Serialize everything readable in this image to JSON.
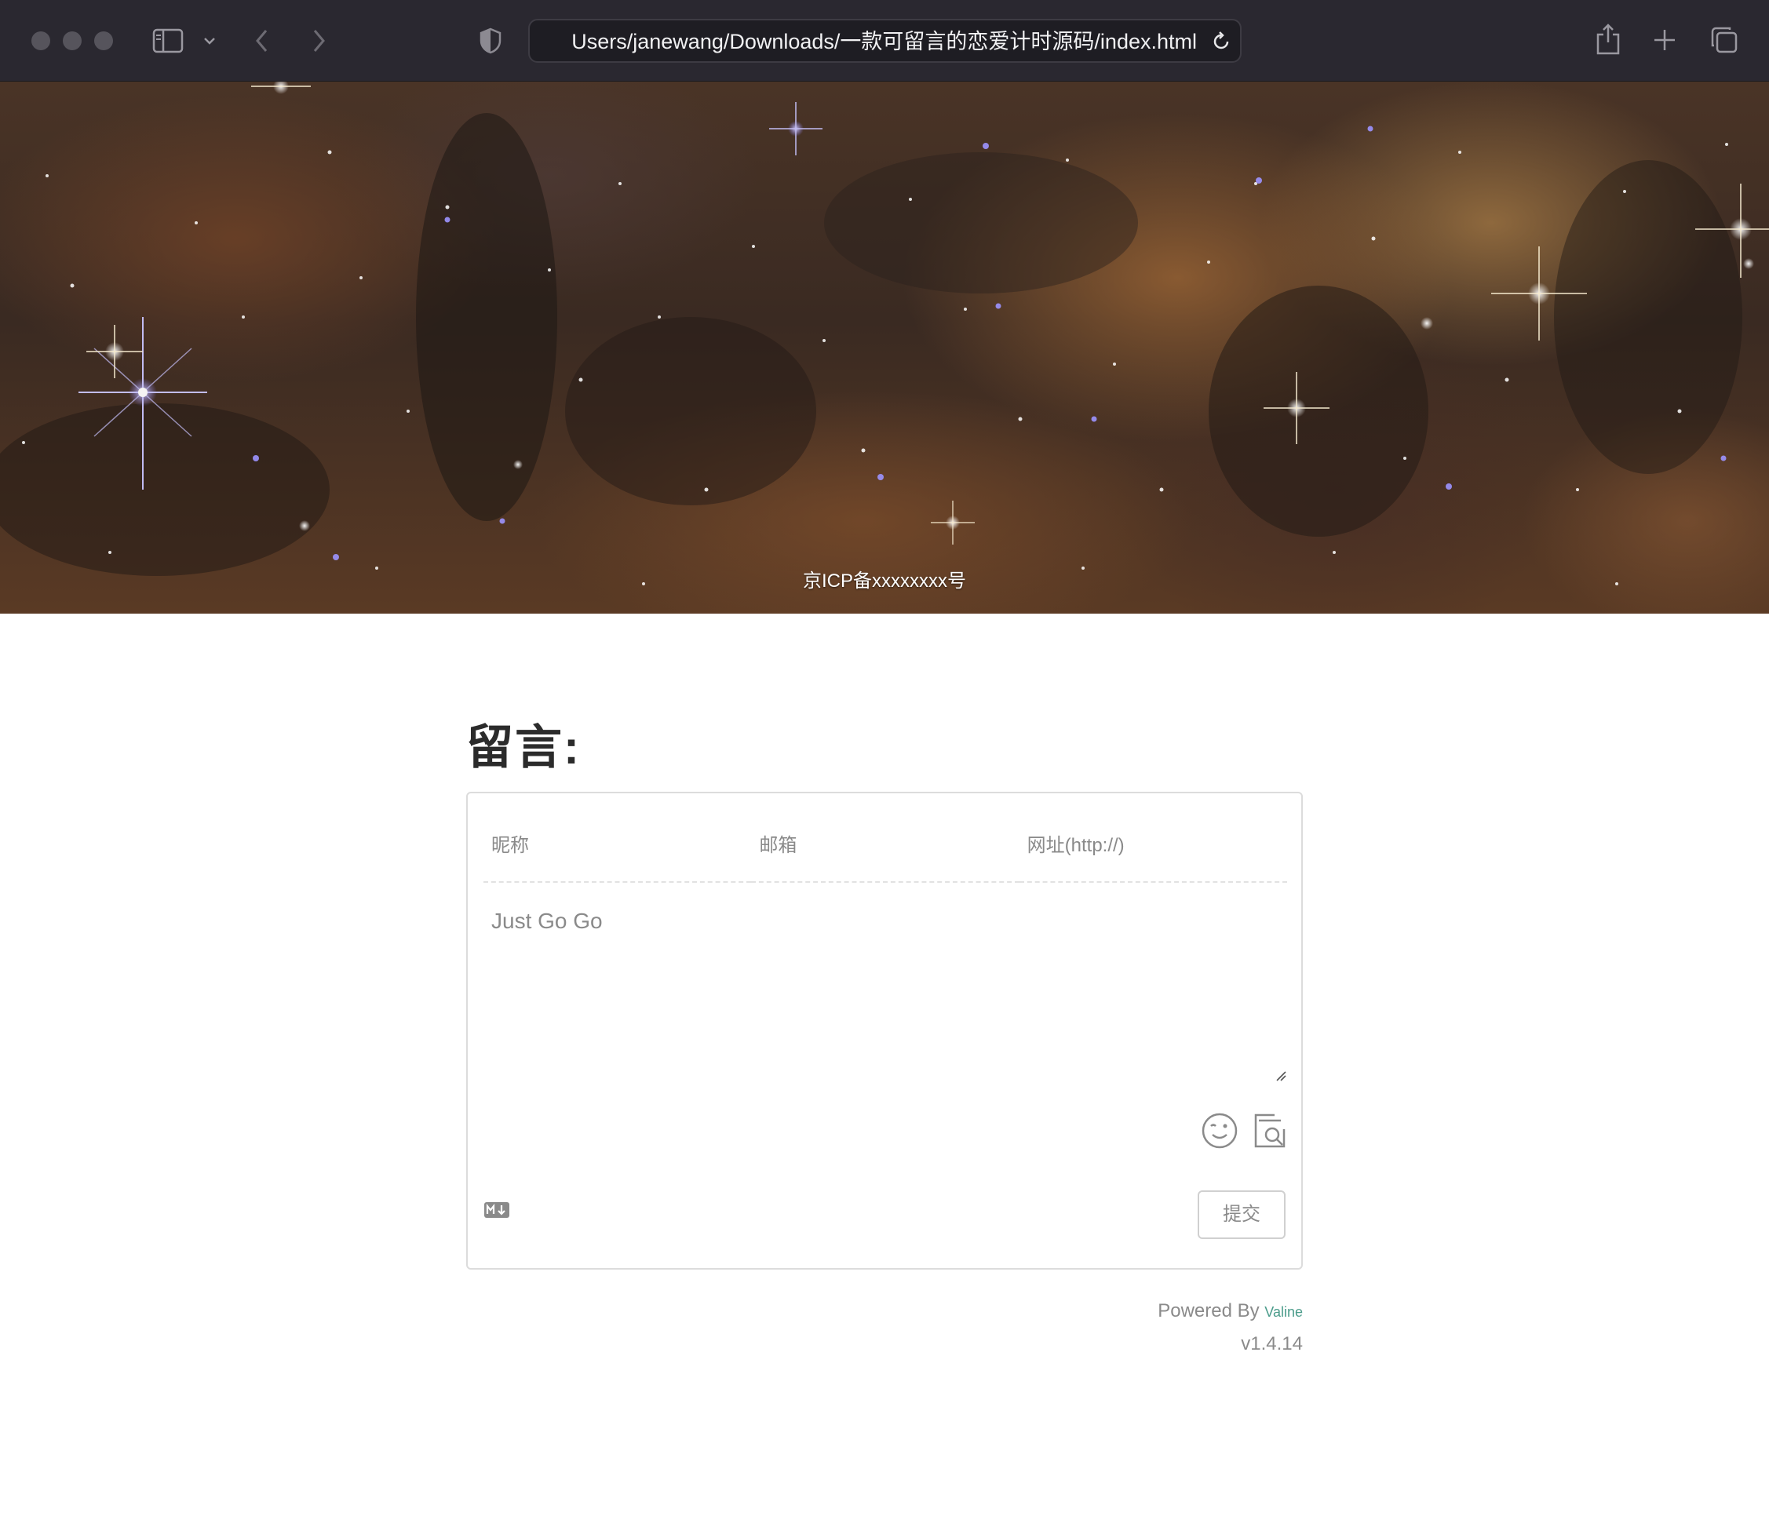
{
  "browser": {
    "url": "Users/janewang/Downloads/一款可留言的恋爱计时源码/index.html",
    "icons": [
      "close-dot",
      "minimize-dot",
      "zoom-dot",
      "sidebar-icon",
      "chevron-down-icon",
      "back-icon",
      "forward-icon",
      "shield-icon",
      "reload-icon",
      "share-icon",
      "plus-icon",
      "tabs-icon"
    ]
  },
  "hero": {
    "icp_text": "京ICP备xxxxxxxx号"
  },
  "comments": {
    "title": "留言:",
    "nickname_placeholder": "昵称",
    "email_placeholder": "邮箱",
    "website_placeholder": "网址(http://)",
    "content_placeholder": "Just Go Go",
    "submit_label": "提交",
    "markdown_badge": "M↓",
    "powered_prefix": "Powered By",
    "powered_brand": "Valine",
    "version": "v1.4.14"
  }
}
